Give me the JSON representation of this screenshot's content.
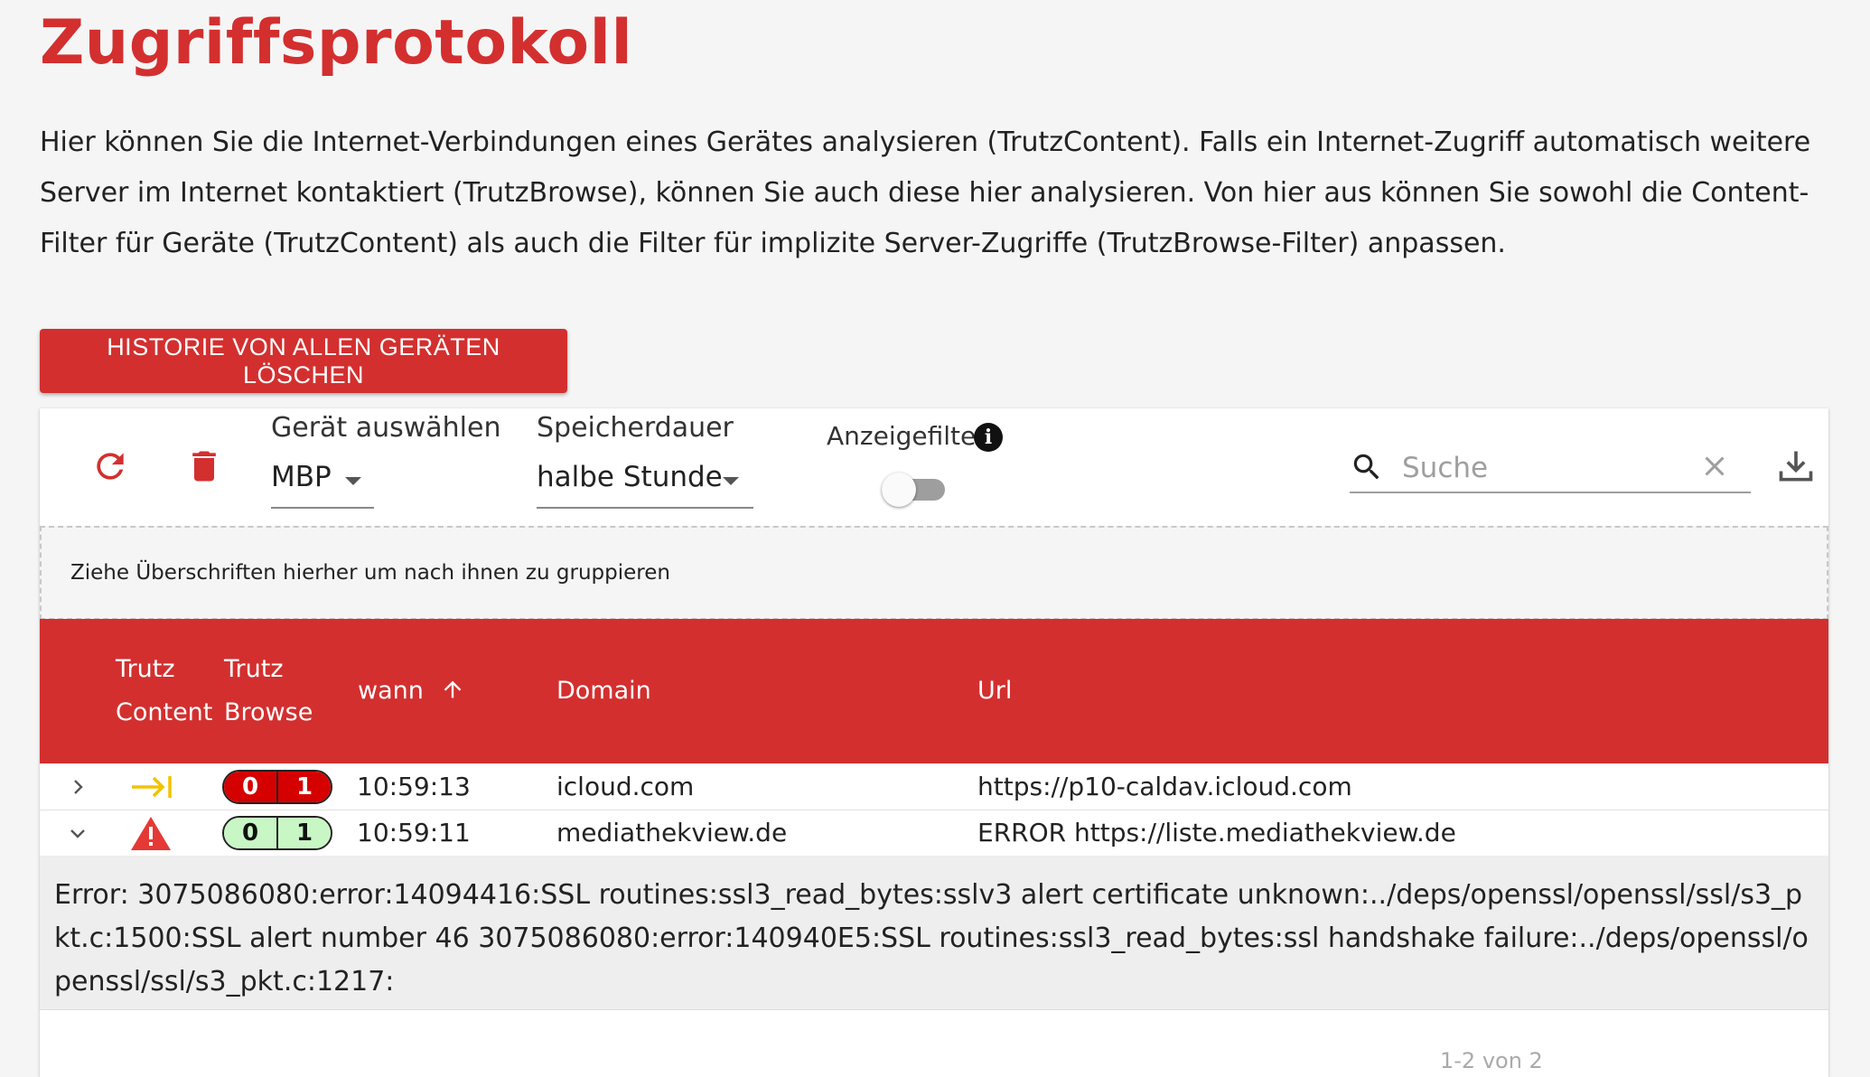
{
  "page": {
    "title": "Zugriffsprotokoll",
    "intro": "Hier können Sie die Internet-Verbindungen eines Gerätes analysieren (TrutzContent). Falls ein Internet-Zugriff automatisch weitere Server im Internet kontaktiert (TrutzBrowse), können Sie auch diese hier analysieren. Von hier aus können Sie sowohl die Content-Filter für Geräte (TrutzContent) als auch die Filter für implizite Server-Zugriffe (TrutzBrowse-Filter) anpassen.",
    "clear_button": "HISTORIE VON ALLEN GERÄTEN LÖSCHEN"
  },
  "toolbar": {
    "refresh_icon": "refresh-icon",
    "delete_icon": "trash-icon",
    "device_label": "Gerät auswählen",
    "device_value": "MBP",
    "retention_label": "Speicherdauer",
    "retention_value": "halbe Stunde",
    "filter_label": "Anzeigefilter",
    "filter_on": false,
    "search_placeholder": "Suche",
    "search_value": "",
    "download_icon": "download-icon"
  },
  "group_hint": "Ziehe Überschriften hierher um nach ihnen zu gruppieren",
  "columns": {
    "trutz_content_1": "Trutz",
    "trutz_content_2": "Content",
    "trutz_browse_1": "Trutz",
    "trutz_browse_2": "Browse",
    "wann": "wann",
    "domain": "Domain",
    "url": "Url"
  },
  "rows": [
    {
      "expanded": false,
      "content_icon": "arrow-to-right-icon",
      "browse_blocked": "0",
      "browse_allowed": "1",
      "badge_color": "red",
      "time": "10:59:13",
      "domain": "icloud.com",
      "url": "https://p10-caldav.icloud.com"
    },
    {
      "expanded": true,
      "content_icon": "warning-icon",
      "browse_blocked": "0",
      "browse_allowed": "1",
      "badge_color": "green",
      "time": "10:59:11",
      "domain": "mediathekview.de",
      "url": "ERROR https://liste.mediathekview.de"
    }
  ],
  "detail_error": "Error: 3075086080:error:14094416:SSL routines:ssl3_read_bytes:sslv3 alert certificate unknown:../deps/openssl/openssl/ssl/s3_pkt.c:1500:SSL alert number 46 3075086080:error:140940E5:SSL routines:ssl3_read_bytes:ssl handshake failure:../deps/openssl/openssl/ssl/s3_pkt.c:1217:",
  "pager": {
    "text": "1-2 von 2"
  },
  "colors": {
    "accent": "#d32f2f",
    "badge_red": "#d50000",
    "badge_green": "#c8f7c5",
    "warning": "#e53935",
    "arrow": "#f2c200"
  }
}
